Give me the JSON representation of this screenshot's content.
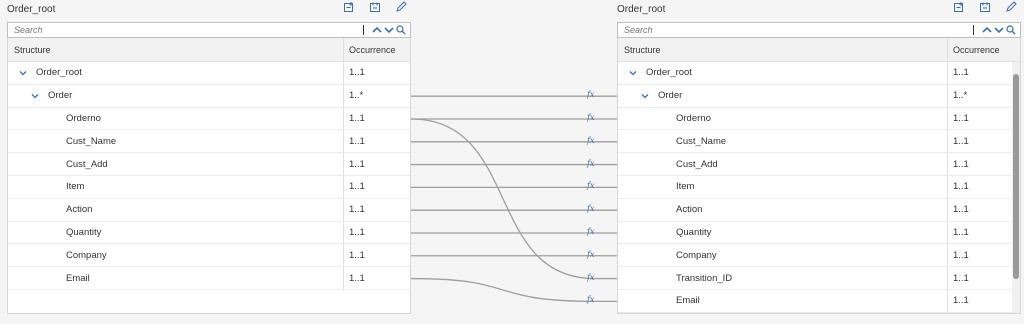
{
  "source": {
    "title": "Order_root",
    "search_placeholder": "Search",
    "col_structure": "Structure",
    "col_occurrence": "Occurrence",
    "rows": [
      {
        "name": "Order_root",
        "occ": "1..1"
      },
      {
        "name": "Order",
        "occ": "1..*"
      },
      {
        "name": "Orderno",
        "occ": "1..1"
      },
      {
        "name": "Cust_Name",
        "occ": "1..1"
      },
      {
        "name": "Cust_Add",
        "occ": "1..1"
      },
      {
        "name": "Item",
        "occ": "1..1"
      },
      {
        "name": "Action",
        "occ": "1..1"
      },
      {
        "name": "Quantity",
        "occ": "1..1"
      },
      {
        "name": "Company",
        "occ": "1..1"
      },
      {
        "name": "Email",
        "occ": "1..1"
      }
    ]
  },
  "target": {
    "title": "Order_root",
    "search_placeholder": "Search",
    "col_structure": "Structure",
    "col_occurrence": "Occurrence",
    "rows": [
      {
        "name": "Order_root",
        "occ": "1..1"
      },
      {
        "name": "Order",
        "occ": "1..*"
      },
      {
        "name": "Orderno",
        "occ": "1..1"
      },
      {
        "name": "Cust_Name",
        "occ": "1..1"
      },
      {
        "name": "Cust_Add",
        "occ": "1..1"
      },
      {
        "name": "Item",
        "occ": "1..1"
      },
      {
        "name": "Action",
        "occ": "1..1"
      },
      {
        "name": "Quantity",
        "occ": "1..1"
      },
      {
        "name": "Company",
        "occ": "1..1"
      },
      {
        "name": "Transition_ID",
        "occ": "1..1"
      },
      {
        "name": "Email",
        "occ": "1..1"
      }
    ]
  },
  "mappings": [
    {
      "from": 1,
      "to": 1
    },
    {
      "from": 2,
      "to": 2
    },
    {
      "from": 2,
      "to": 9
    },
    {
      "from": 3,
      "to": 3
    },
    {
      "from": 4,
      "to": 4
    },
    {
      "from": 5,
      "to": 5
    },
    {
      "from": 6,
      "to": 6
    },
    {
      "from": 7,
      "to": 7
    },
    {
      "from": 8,
      "to": 8
    },
    {
      "from": 9,
      "to": 10
    }
  ],
  "function_icon": "fx",
  "colors": {
    "accent": "#3a6fb0",
    "line": "#9e9e9e"
  }
}
